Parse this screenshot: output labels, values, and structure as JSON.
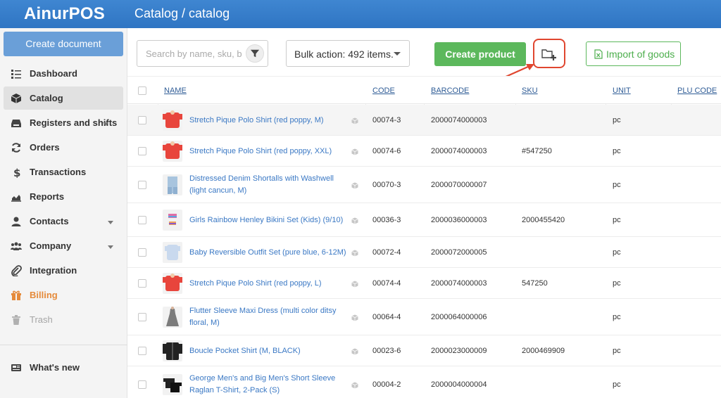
{
  "app": {
    "brand": "AinurPOS",
    "breadcrumb": "Catalog / catalog"
  },
  "colors": {
    "topbar": "#3a80cc",
    "accent_green": "#5cb85c",
    "link": "#3a78c4",
    "billing": "#e58a3a",
    "highlight_red": "#e0462f"
  },
  "sidebar": {
    "create_label": "Create document",
    "items": [
      {
        "label": "Dashboard",
        "icon": "dashboard-icon"
      },
      {
        "label": "Catalog",
        "icon": "box-icon",
        "active": true
      },
      {
        "label": "Registers and shifts",
        "icon": "register-icon",
        "has_caret": true
      },
      {
        "label": "Orders",
        "icon": "refresh-icon"
      },
      {
        "label": "Transactions",
        "icon": "dollar-icon"
      },
      {
        "label": "Reports",
        "icon": "chart-icon"
      },
      {
        "label": "Contacts",
        "icon": "user-icon",
        "has_caret": true
      },
      {
        "label": "Company",
        "icon": "users-icon",
        "has_caret": true
      },
      {
        "label": "Integration",
        "icon": "paperclip-icon"
      },
      {
        "label": "Billing",
        "icon": "gift-icon"
      },
      {
        "label": "Trash",
        "icon": "trash-icon"
      }
    ],
    "whats_new": "What's new"
  },
  "toolbar": {
    "search_placeholder": "Search by name, sku, b",
    "bulk_label": "Bulk action: 492 items.",
    "create_product": "Create product",
    "import_label": "Import of goods"
  },
  "table": {
    "columns": {
      "name": "NAME",
      "code": "CODE",
      "barcode": "BARCODE",
      "sku": "SKU",
      "unit": "UNIT",
      "plu": "PLU CODE"
    },
    "rows": [
      {
        "name": "Stretch Pique Polo Shirt (red poppy, M)",
        "code": "00074-3",
        "barcode": "2000074000003",
        "sku": "",
        "unit": "pc",
        "thumb": "red-shirt"
      },
      {
        "name": "Stretch Pique Polo Shirt (red poppy, XXL)",
        "code": "00074-6",
        "barcode": "2000074000003",
        "sku": "#547250",
        "unit": "pc",
        "thumb": "red-shirt"
      },
      {
        "name": "Distressed Denim Shortalls with Washwell (light cancun, M)",
        "code": "00070-3",
        "barcode": "2000070000007",
        "sku": "",
        "unit": "pc",
        "thumb": "denim"
      },
      {
        "name": "Girls Rainbow Henley Bikini Set (Kids) (9/10)",
        "code": "00036-3",
        "barcode": "2000036000003",
        "sku": "2000455420",
        "unit": "pc",
        "thumb": "bikini"
      },
      {
        "name": "Baby Reversible Outfit Set (pure blue, 6-12M)",
        "code": "00072-4",
        "barcode": "2000072000005",
        "sku": "",
        "unit": "pc",
        "thumb": "baby"
      },
      {
        "name": "Stretch Pique Polo Shirt (red poppy, L)",
        "code": "00074-4",
        "barcode": "2000074000003",
        "sku": "547250",
        "unit": "pc",
        "thumb": "red-shirt"
      },
      {
        "name": "Flutter Sleeve Maxi Dress (multi color ditsy floral, M)",
        "code": "00064-4",
        "barcode": "2000064000006",
        "sku": "",
        "unit": "pc",
        "thumb": "dress"
      },
      {
        "name": "Boucle Pocket Shirt (M, BLACK)",
        "code": "00023-6",
        "barcode": "2000023000009",
        "sku": "2000469909",
        "unit": "pc",
        "thumb": "black-shirt"
      },
      {
        "name": "George Men's and Big Men's Short Sleeve Raglan T-Shirt, 2-Pack (S)",
        "code": "00004-2",
        "barcode": "2000004000004",
        "sku": "",
        "unit": "pc",
        "thumb": "tshirts"
      }
    ]
  }
}
